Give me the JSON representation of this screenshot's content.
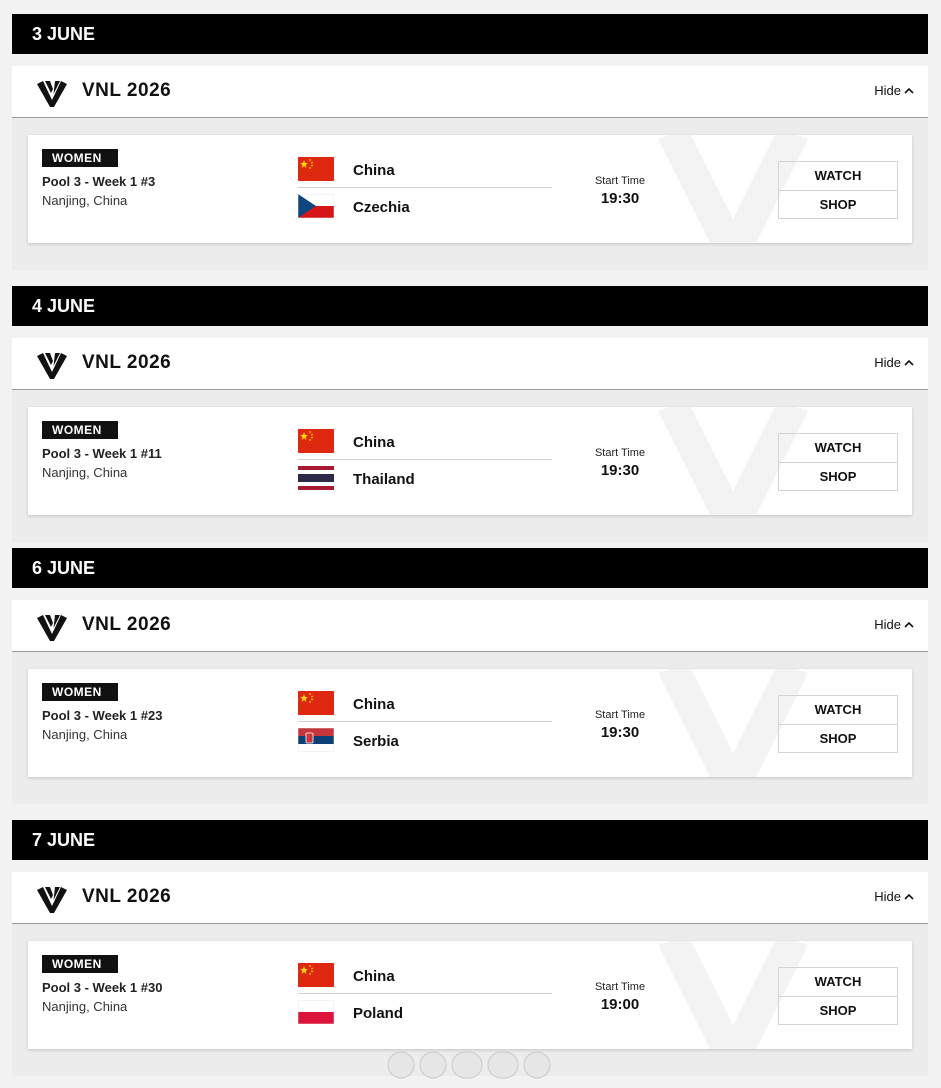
{
  "days": [
    {
      "date": "3 JUNE",
      "competition": {
        "title": "VNL 2026",
        "toggle_label": "Hide",
        "toggle_icon": "chevron-up-icon"
      },
      "match": {
        "gender": "WOMEN",
        "pool": "Pool 3 - Week 1 #3",
        "venue": "Nanjing, China",
        "home": {
          "name": "China",
          "flag": "china-flag"
        },
        "away": {
          "name": "Czechia",
          "flag": "czechia-flag"
        },
        "start_label": "Start Time",
        "start_time": "19:30",
        "watch_label": "WATCH",
        "shop_label": "SHOP"
      }
    },
    {
      "date": "4 JUNE",
      "competition": {
        "title": "VNL 2026",
        "toggle_label": "Hide",
        "toggle_icon": "chevron-up-icon"
      },
      "match": {
        "gender": "WOMEN",
        "pool": "Pool 3 - Week 1 #11",
        "venue": "Nanjing, China",
        "home": {
          "name": "China",
          "flag": "china-flag"
        },
        "away": {
          "name": "Thailand",
          "flag": "thailand-flag"
        },
        "start_label": "Start Time",
        "start_time": "19:30",
        "watch_label": "WATCH",
        "shop_label": "SHOP"
      }
    },
    {
      "date": "6 JUNE",
      "competition": {
        "title": "VNL 2026",
        "toggle_label": "Hide",
        "toggle_icon": "chevron-up-icon"
      },
      "match": {
        "gender": "WOMEN",
        "pool": "Pool 3 - Week 1 #23",
        "venue": "Nanjing, China",
        "home": {
          "name": "China",
          "flag": "china-flag"
        },
        "away": {
          "name": "Serbia",
          "flag": "serbia-flag"
        },
        "start_label": "Start Time",
        "start_time": "19:30",
        "watch_label": "WATCH",
        "shop_label": "SHOP"
      }
    },
    {
      "date": "7 JUNE",
      "competition": {
        "title": "VNL 2026",
        "toggle_label": "Hide",
        "toggle_icon": "chevron-up-icon"
      },
      "match": {
        "gender": "WOMEN",
        "pool": "Pool 3 - Week 1 #30",
        "venue": "Nanjing, China",
        "home": {
          "name": "China",
          "flag": "china-flag"
        },
        "away": {
          "name": "Poland",
          "flag": "poland-flag"
        },
        "start_label": "Start Time",
        "start_time": "19:00",
        "watch_label": "WATCH",
        "shop_label": "SHOP"
      }
    }
  ],
  "colors": {
    "date_bar": "#000000",
    "badge": "#111111",
    "china_red": "#de2910",
    "china_star": "#ffde00"
  }
}
